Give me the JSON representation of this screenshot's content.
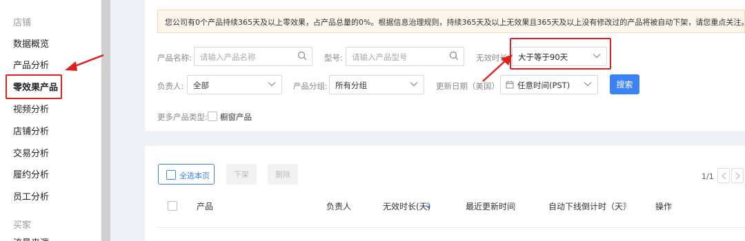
{
  "sidebar": {
    "section_store": "店铺",
    "items": [
      {
        "label": "数据概览"
      },
      {
        "label": "产品分析"
      },
      {
        "label": "零效果产品"
      },
      {
        "label": "视频分析"
      },
      {
        "label": "店铺分析"
      },
      {
        "label": "交易分析"
      },
      {
        "label": "履约分析"
      },
      {
        "label": "员工分析"
      }
    ],
    "section_buyer": "买家",
    "partial_item": "流量来源"
  },
  "notice": {
    "text": "您公司有0个产品持续365天及以上零效果，占产品总量的0%。根据信息治理规则，持续365天及以上无效果且365天及以上没有修改过的产品将被自动下架，请您重点关注。"
  },
  "filters": {
    "product_name_label": "产品名称:",
    "product_name_placeholder": "请输入产品名称",
    "model_label": "型号:",
    "model_placeholder": "请输入产品型号",
    "invalid_duration_label": "无效时长",
    "invalid_duration_value": "大于等于90天",
    "owner_label": "负责人:",
    "owner_value": "全部",
    "group_label": "产品分组:",
    "group_value": "所有分组",
    "update_date_label": "更新日期（美国）:",
    "update_date_value": "任意时间(PST)",
    "search_button": "搜索",
    "more_types_label": "更多产品类型:",
    "showcase_label": "橱窗产品"
  },
  "toolbar": {
    "select_page": "全选本页",
    "delist": "下架",
    "delete": "删除"
  },
  "pagination": {
    "text": "1/1"
  },
  "table": {
    "headers": [
      "产品",
      "负责人",
      "无效时长(天)",
      "最近更新时间",
      "自动下线倒计时（天）",
      "操作"
    ]
  },
  "colors": {
    "accent": "#3b82f6",
    "highlight": "#e02020",
    "notice_bg": "#fdf6ec"
  }
}
